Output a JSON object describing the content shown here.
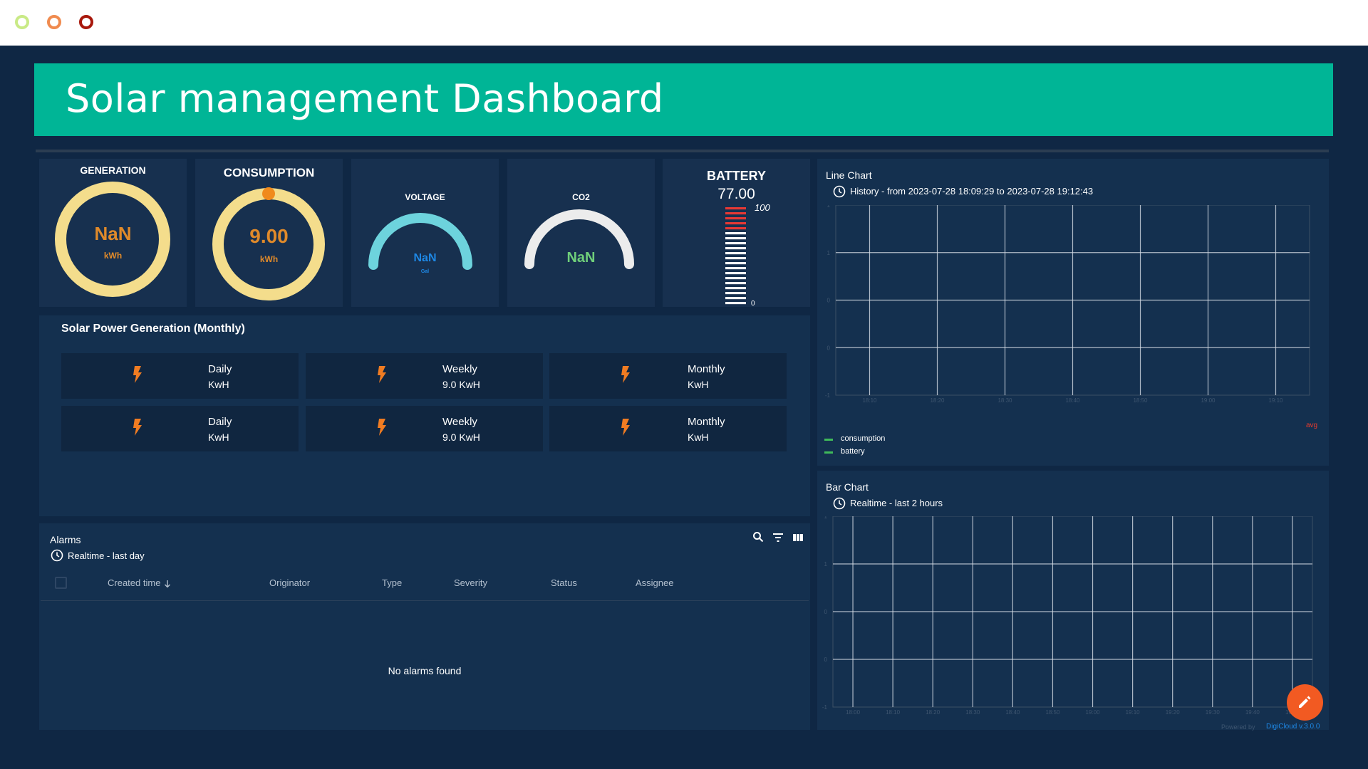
{
  "window": {
    "title": "Solar management Dashboard"
  },
  "colors": {
    "accent": "#00b596",
    "background": "#0f2744",
    "gauge_ring": "#f4dd8c",
    "gauge_text": "#e08a2a",
    "fab": "#f25a22",
    "legend": "#3fba5a"
  },
  "gauges": {
    "generation": {
      "title": "GENERATION",
      "value": "NaN",
      "unit": "kWh"
    },
    "consumption": {
      "title": "CONSUMPTION",
      "value": "9.00",
      "unit": "kWh"
    },
    "voltage": {
      "title": "VOLTAGE",
      "value": "NaN",
      "unit": "Gal"
    },
    "co2": {
      "title": "CO2",
      "value": "NaN"
    },
    "battery": {
      "title": "BATTERY",
      "value": "77.00",
      "max_label": "100",
      "min_label": "0",
      "level_fraction": 0.77
    }
  },
  "solar_power": {
    "title": "Solar Power Generation (Monthly)",
    "cards": [
      {
        "label": "Daily",
        "value": "KwH",
        "icon": "bolt-icon"
      },
      {
        "label": "Weekly",
        "value": "9.0 KwH",
        "icon": "bolt-icon"
      },
      {
        "label": "Monthly",
        "value": "KwH",
        "icon": "bolt-icon"
      },
      {
        "label": "Daily",
        "value": "KwH",
        "icon": "bolt-icon"
      },
      {
        "label": "Weekly",
        "value": "9.0 KwH",
        "icon": "bolt-icon"
      },
      {
        "label": "Monthly",
        "value": "KwH",
        "icon": "bolt-icon"
      }
    ]
  },
  "alarms": {
    "title": "Alarms",
    "subtitle": "Realtime - last day",
    "columns": [
      "Created time",
      "Originator",
      "Type",
      "Severity",
      "Status",
      "Assignee"
    ],
    "empty_text": "No alarms found",
    "icons": [
      "search-icon",
      "filter-icon",
      "columns-icon"
    ]
  },
  "line_chart": {
    "title": "Line Chart",
    "subtitle": "History - from 2023-07-28 18:09:29 to 2023-07-28 19:12:43",
    "legend": [
      "consumption",
      "battery"
    ],
    "avg_label": "avg"
  },
  "bar_chart": {
    "title": "Bar Chart",
    "subtitle": "Realtime - last 2 hours"
  },
  "footer": {
    "powered": "Powered by",
    "version": "DigiCloud v.3.0.0"
  },
  "chart_data": [
    {
      "type": "line",
      "title": "Line Chart",
      "x": [
        "18:10",
        "18:20",
        "18:30",
        "18:40",
        "18:50",
        "19:00",
        "19:10"
      ],
      "y_ticks": [
        "1",
        "1",
        "0",
        "0",
        "-1"
      ],
      "series": [
        {
          "name": "consumption",
          "values": []
        },
        {
          "name": "battery",
          "values": []
        }
      ],
      "grid": true
    },
    {
      "type": "bar",
      "title": "Bar Chart",
      "x": [
        "18:00",
        "18:10",
        "18:20",
        "18:30",
        "18:40",
        "18:50",
        "19:00",
        "19:10",
        "19:20",
        "19:30",
        "19:40",
        "19:50"
      ],
      "y_ticks": [
        "1",
        "1",
        "0",
        "0",
        "-1"
      ],
      "series": [],
      "grid": true
    }
  ]
}
